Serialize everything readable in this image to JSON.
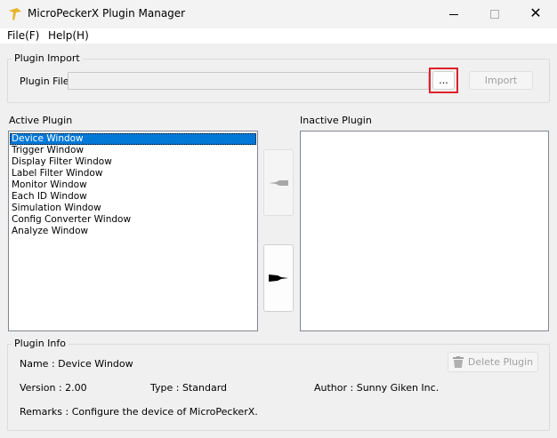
{
  "window": {
    "title": "MicroPeckerX Plugin Manager"
  },
  "menu": {
    "file": "File(F)",
    "help": "Help(H)"
  },
  "import": {
    "group": "Plugin Import",
    "file_label": "Plugin File",
    "file_value": "",
    "browse": "...",
    "import": "Import"
  },
  "active": {
    "label": "Active Plugin",
    "items": [
      "Device Window",
      "Trigger Window",
      "Display Filter Window",
      "Label Filter Window",
      "Monitor Window",
      "Each ID Window",
      "Simulation Window",
      "Config Converter Window",
      "Analyze Window"
    ]
  },
  "inactive": {
    "label": "Inactive Plugin"
  },
  "info": {
    "group": "Plugin Info",
    "name": "Name : Device Window",
    "version": "Version : 2.00",
    "type": "Type : Standard",
    "author": "Author : Sunny Giken Inc.",
    "remarks": "Remarks : Configure the device of MicroPeckerX.",
    "delete": "Delete Plugin"
  },
  "colors": {
    "highlight": "#0078d7",
    "focus_box": "#e0202a"
  }
}
